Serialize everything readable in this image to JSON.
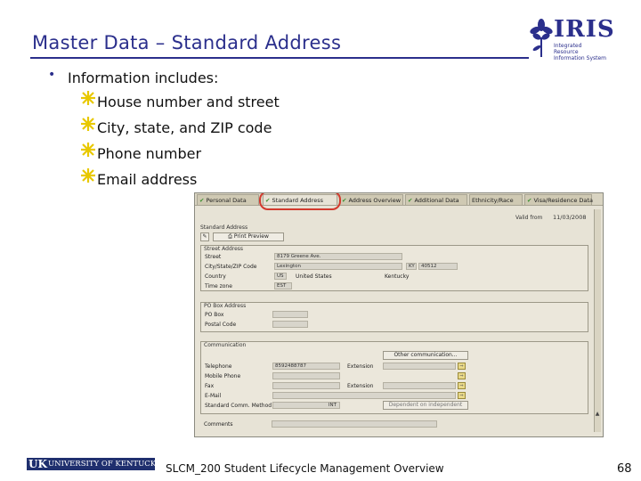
{
  "slide": {
    "title": "Master Data – Standard Address",
    "bullet": "Information includes:",
    "sub_items": [
      "House number and street",
      "City, state, and ZIP code",
      "Phone number",
      "Email address"
    ]
  },
  "logo": {
    "name": "IRIS",
    "subtitle": "Integrated Resource Information System"
  },
  "sap": {
    "tabs": [
      "Personal Data",
      "Standard Address",
      "Address Overview",
      "Additional Data",
      "Ethnicity/Race",
      "Visa/Residence Data"
    ],
    "valid_from_label": "Valid from",
    "valid_from": "11/03/2008",
    "section_title": "Standard Address",
    "print_preview": "Print Preview",
    "street_group": {
      "title": "Street Address",
      "street_label": "Street",
      "street_value": "8179 Greene Ave.",
      "city_label": "City/State/ZIP Code",
      "city_value": "Lexington",
      "state_value": "KY",
      "zip_value": "40512",
      "country_label": "Country",
      "country_code": "US",
      "country_name": "United States",
      "region_name": "Kentucky",
      "timezone_label": "Time zone",
      "timezone_value": "EST"
    },
    "pobox_group": {
      "title": "PO Box Address",
      "pobox_label": "PO Box",
      "postal_label": "Postal Code"
    },
    "comm_group": {
      "title": "Communication",
      "other_button": "Other communication...",
      "telephone_label": "Telephone",
      "telephone_value": "8592488787",
      "extension_label": "Extension",
      "mobile_label": "Mobile Phone",
      "fax_label": "Fax",
      "fax_extension_label": "Extension",
      "email_label": "E-Mail",
      "standard_comm_label": "Standard Comm. Method",
      "standard_comm_value": "INT",
      "dependent_button": "Dependent on independent"
    },
    "comments_label": "Comments"
  },
  "footer": {
    "uk_mark": "UK",
    "university": "UNIVERSITY OF KENTUCKY",
    "course": "SLCM_200 Student Lifecycle Management Overview",
    "page": "68"
  },
  "colors": {
    "title": "#2b2f8c",
    "star": "#f2d400",
    "highlight": "#d23a2e"
  }
}
